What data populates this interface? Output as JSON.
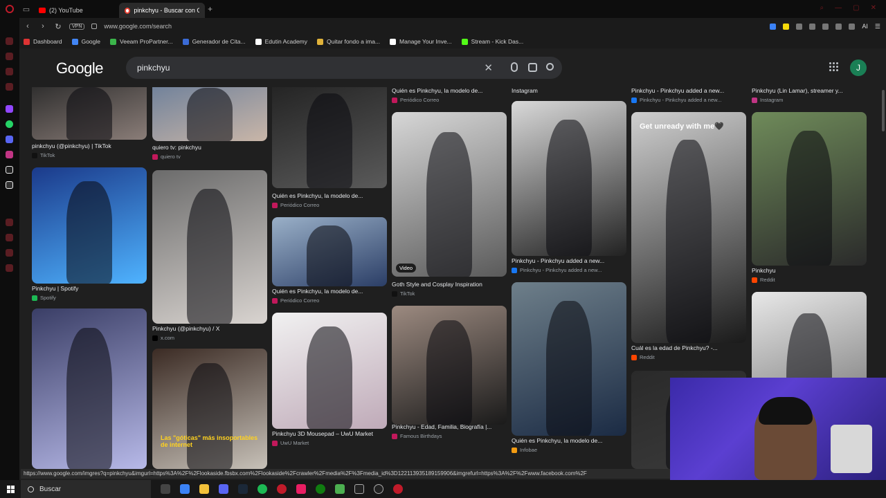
{
  "tabs": [
    {
      "title": "(2) YouTube",
      "active": false
    },
    {
      "title": "pinkchyu - Buscar con Goo",
      "active": true
    }
  ],
  "address": {
    "vpn_label": "VPN",
    "url": "www.google.com/search",
    "ai_label": "AI"
  },
  "bookmarks": [
    {
      "label": "Dashboard",
      "color": "#d33"
    },
    {
      "label": "Google",
      "color": "#4285f4"
    },
    {
      "label": "Veeam ProPartner...",
      "color": "#3bb54a"
    },
    {
      "label": "Generador de Cita...",
      "color": "#3b6bd6"
    },
    {
      "label": "Edutin Academy",
      "color": "#ffffff"
    },
    {
      "label": "Quitar fondo a ima...",
      "color": "#e0b23a"
    },
    {
      "label": "Manage Your Inve...",
      "color": "#ffffff"
    },
    {
      "label": "Stream - Kick Das...",
      "color": "#53fc18"
    }
  ],
  "google": {
    "logo": "Google",
    "query": "pinkchyu",
    "avatar_initial": "J"
  },
  "results": [
    {
      "caption": "pinkchyu (@pinkchyu) | TikTok",
      "source": "TikTok",
      "src_color": "#111",
      "img": [
        "#2a2a2a",
        "#8a7d78"
      ]
    },
    {
      "caption": "Pinkchyu | Spotify",
      "source": "Spotify",
      "src_color": "#1db954",
      "img": [
        "#1b3a8a",
        "#4fb3ff"
      ]
    },
    {
      "caption": "",
      "source": "",
      "src_color": "#000",
      "img": [
        "#3a3e66",
        "#b7b9e8"
      ]
    },
    {
      "caption": "quiero tv: pinkchyu",
      "source": "quiero tv",
      "src_color": "#c2185b",
      "img": [
        "#6c7f9a",
        "#c9b6a8"
      ]
    },
    {
      "caption": "Pinkchyu (@pinkchyu) / X",
      "source": "x.com",
      "src_color": "#000",
      "img": [
        "#6b6b6b",
        "#d9d4d0"
      ]
    },
    {
      "caption": "",
      "source": "",
      "src_color": "#000",
      "img": [
        "#3b2b24",
        "#c7c1b8"
      ]
    },
    {
      "caption": "Quién es Pinkchyu, la modelo de...",
      "source": "Periódico Correo",
      "src_color": "#c2185b",
      "img": [
        "#222",
        "#5a5a5a"
      ]
    },
    {
      "caption": "Quién es Pinkchyu, la modelo de...",
      "source": "Periódico Correo",
      "src_color": "#c2185b",
      "img": [
        "#9ab0c8",
        "#2b3e66"
      ]
    },
    {
      "caption": "Pinkchyu 3D Mousepad – UwU Market",
      "source": "UwU Market",
      "src_color": "#c2185b",
      "img": [
        "#f1f1f1",
        "#bfaab8"
      ]
    },
    {
      "caption": "Quién es Pinkchyu, la modelo de...",
      "source": "Periódico Correo",
      "src_color": "#c2185b",
      "img": [
        "#3a3a3a",
        "#777"
      ]
    },
    {
      "caption": "Goth Style and Cosplay Inspiration",
      "source": "TikTok",
      "src_color": "#111",
      "img": [
        "#d7d7d7",
        "#5a5a5a"
      ]
    },
    {
      "caption": "Pinkchyu - Edad, Familia, Biografía |...",
      "source": "Famous Birthdays",
      "src_color": "#c2185b",
      "img": [
        "#9c8a80",
        "#1a1a1a"
      ]
    },
    {
      "caption": "Instagram",
      "source": "",
      "src_color": "#c13584",
      "img": [
        "#3a3a3a",
        "#3a3a3a"
      ]
    },
    {
      "caption": "Pinkchyu - Pinkchyu added a new...",
      "source": "Pinkchyu - Pinkchyu added a new...",
      "src_color": "#1877f2",
      "img": [
        "#d9d9d9",
        "#222"
      ]
    },
    {
      "caption": "Quién es Pinkchyu, la modelo de...",
      "source": "Infobae",
      "src_color": "#f39c12",
      "img": [
        "#6e7f8a",
        "#1b2b44"
      ]
    },
    {
      "caption": "Pinkchyu - Pinkchyu added a new...",
      "source": "Pinkchyu - Pinkchyu added a new...",
      "src_color": "#1877f2",
      "img": [
        "#cfcfcf",
        "#1a1a1a"
      ],
      "overlay": "Get unready with me🖤"
    },
    {
      "caption": "Cuál es la edad de Pinkchyu? -...",
      "source": "Reddit",
      "src_color": "#ff4500",
      "img": [
        "#2a2a2a",
        "#3a3a3a"
      ]
    },
    {
      "caption": "Pinkchyu (Lin Lamar), streamer y...",
      "source": "Instagram",
      "src_color": "#c13584",
      "img": [
        "#6f8b5a",
        "#2a2a2a"
      ]
    },
    {
      "caption": "Pinkchyu",
      "source": "Reddit",
      "src_color": "#ff4500",
      "img": [
        "#e8e8e8",
        "#555"
      ]
    }
  ],
  "video_badge": "Video",
  "meme_text": "Las \"góticas\" más insoportables de internet",
  "status_url": "https://www.google.com/imgres?q=pinkchyu&imgurl=https%3A%2F%2Flookaside.fbsbx.com%2Flookaside%2Fcrawler%2Fmedia%2F%3Fmedia_id%3D122113935189159906&imgrefurl=https%3A%2F%2Fwww.facebook.com%2F",
  "taskbar": {
    "search_label": "Buscar"
  }
}
